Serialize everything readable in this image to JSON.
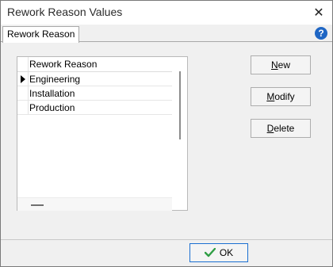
{
  "window": {
    "title": "Rework Reason Values"
  },
  "tabs": [
    {
      "label": "Rework Reason"
    }
  ],
  "grid": {
    "header": "Rework Reason",
    "rows": [
      {
        "value": "Engineering",
        "current": true
      },
      {
        "value": "Installation",
        "current": false
      },
      {
        "value": "Production",
        "current": false
      }
    ]
  },
  "buttons": {
    "new_first": "N",
    "new_rest": "ew",
    "modify_first": "M",
    "modify_rest": "odify",
    "delete_first": "D",
    "delete_rest": "elete",
    "ok": "OK"
  },
  "colors": {
    "accent": "#1a6fd1",
    "check": "#2f9e44",
    "help": "#1f66c4"
  },
  "icons": [
    "close-icon",
    "help-icon",
    "row-pointer-icon",
    "checkmark-icon"
  ]
}
